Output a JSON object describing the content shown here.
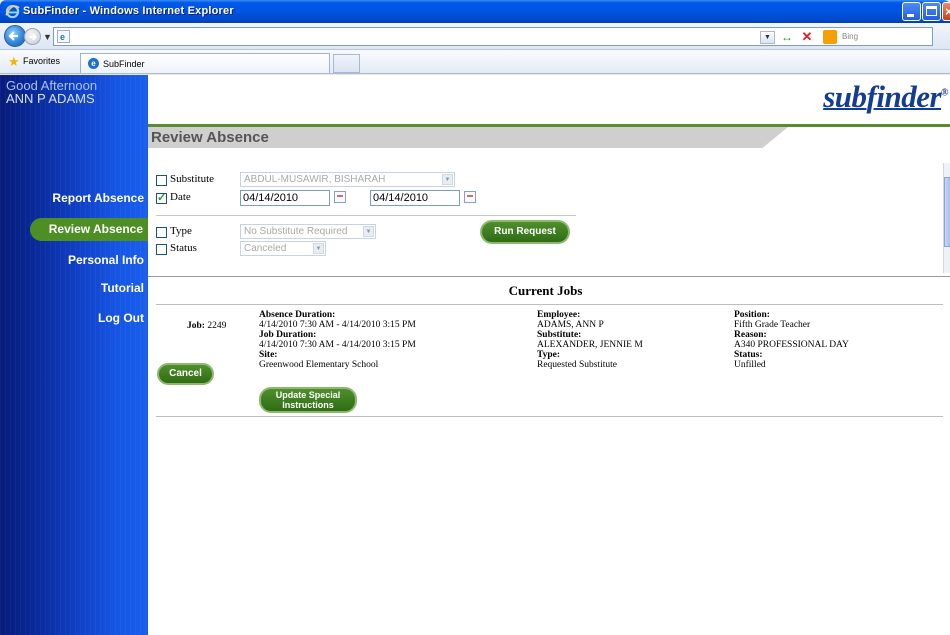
{
  "browser": {
    "window_title": "SubFinder - Windows Internet Explorer",
    "address": "",
    "search_placeholder": "Bing",
    "favorites_label": "Favorites",
    "tab_label": "SubFinder"
  },
  "sidebar": {
    "greeting": "Good Afternoon",
    "user_name": "ANN P ADAMS",
    "items": [
      {
        "label": "Report Absence",
        "active": false
      },
      {
        "label": "Review Absence",
        "active": true
      },
      {
        "label": "Personal Info",
        "active": false
      },
      {
        "label": "Tutorial",
        "active": false
      },
      {
        "label": "Log Out",
        "active": false
      }
    ]
  },
  "header": {
    "logo_sub": "sub",
    "logo_finder": "finder",
    "logo_reg": "®",
    "section_title": "Review Absence"
  },
  "filters": {
    "substitute": {
      "label": "Substitute",
      "checked": false,
      "value": "ABDUL-MUSAWIR, BISHARAH"
    },
    "date": {
      "label": "Date",
      "checked": true,
      "from": "04/14/2010",
      "to": "04/14/2010"
    },
    "type": {
      "label": "Type",
      "checked": false,
      "value": "No Substitute Required"
    },
    "status": {
      "label": "Status",
      "checked": false,
      "value": "Canceled"
    },
    "run_button": "Run Request"
  },
  "jobs": {
    "title": "Current Jobs",
    "items": [
      {
        "job_label": "Job:",
        "job_number": "2249",
        "cancel_button": "Cancel",
        "absence_duration_label": "Absence Duration:",
        "absence_duration": "4/14/2010 7:30 AM - 4/14/2010 3:15 PM",
        "job_duration_label": "Job Duration:",
        "job_duration": "4/14/2010 7:30 AM - 4/14/2010 3:15 PM",
        "site_label": "Site:",
        "site": "Greenwood Elementary School",
        "update_button_line1": "Update Special",
        "update_button_line2": "Instructions",
        "employee_label": "Employee:",
        "employee": "ADAMS, ANN P",
        "substitute_label": "Substitute:",
        "substitute": "ALEXANDER, JENNIE M",
        "type_label": "Type:",
        "type": "Requested Substitute",
        "position_label": "Position:",
        "position": "Fifth Grade Teacher",
        "reason_label": "Reason:",
        "reason": "A340 PROFESSIONAL DAY",
        "status_label": "Status:",
        "status": "Unfilled"
      }
    ]
  },
  "colors": {
    "accent_green": "#4e8f25",
    "sidebar_blue": "#1142c9",
    "logo_blue": "#133c93"
  }
}
